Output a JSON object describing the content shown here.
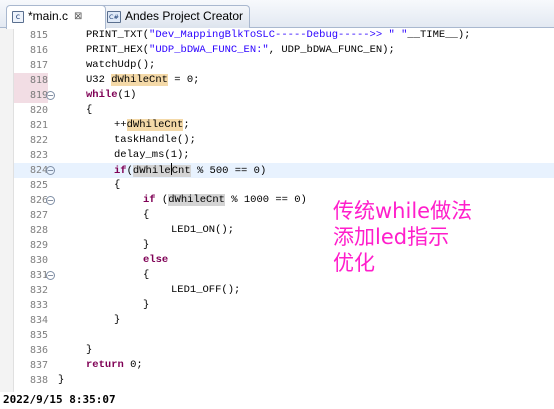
{
  "tabs": [
    {
      "icon": "c-file-icon",
      "label": "*main.c",
      "close_glyph": "⊠"
    },
    {
      "icon": "c-file-icon",
      "label": "Andes Project Creator"
    }
  ],
  "ficon_glyphs": {
    "c": "c",
    "cfg": "C#"
  },
  "editor": {
    "line_numbers": [
      "815",
      "816",
      "817",
      "818",
      "819",
      "820",
      "821",
      "822",
      "823",
      "824",
      "825",
      "826",
      "827",
      "828",
      "829",
      "830",
      "831",
      "832",
      "833",
      "834",
      "835",
      "836",
      "837",
      "838"
    ],
    "code": {
      "l815_a": "PRINT_TXT(",
      "l815_s1": "\"Dev_MappingBlkToSLC-----Debug----->> \"",
      "l815_b": " ",
      "l815_s2": "__TIME__",
      "l815_c": ");",
      "l816_a": "PRINT_HEX(",
      "l816_s": "\"UDP_bDWA_FUNC_EN:\"",
      "l816_b": ", UDP_bDWA_FUNC_EN);",
      "l817": "watchUdp();",
      "l818_a": "U32 ",
      "l818_var": "dWhileCnt",
      "l818_b": " = 0;",
      "l819_kw": "while",
      "l819_b": "(1)",
      "l820": "{",
      "l821_a": "++",
      "l821_var": "dWhileCnt",
      "l821_b": ";",
      "l822": "taskHandle();",
      "l823": "delay_ms(1);",
      "l824_kw": "if",
      "l824_a": "(",
      "l824_var1": "dWhile",
      "l824_var2": "Cnt",
      "l824_b": " % 500 == 0)",
      "l825": "{",
      "l826_kw": "if",
      "l826_a": " (",
      "l826_var": "dWhileCnt",
      "l826_b": " % 1000 == 0)",
      "l827": "{",
      "l828": "LED1_ON();",
      "l829": "}",
      "l830_kw": "else",
      "l831": "{",
      "l832": "LED1_OFF();",
      "l833": "}",
      "l834": "}",
      "l836": "}",
      "l837_kw": "return",
      "l837_b": " 0;",
      "l838": "}"
    }
  },
  "annotation": {
    "line1": "传统while做法",
    "line2": "添加led指示",
    "line3": "优化"
  },
  "timestamp": "2022/9/15 8:35:07",
  "colors": {
    "keyword": "#7f0055",
    "string": "#2a00ff",
    "occurrence_highlight": "#f4d9a8",
    "current_line": "#e8f2fe",
    "annotation": "#ff1ecb"
  }
}
